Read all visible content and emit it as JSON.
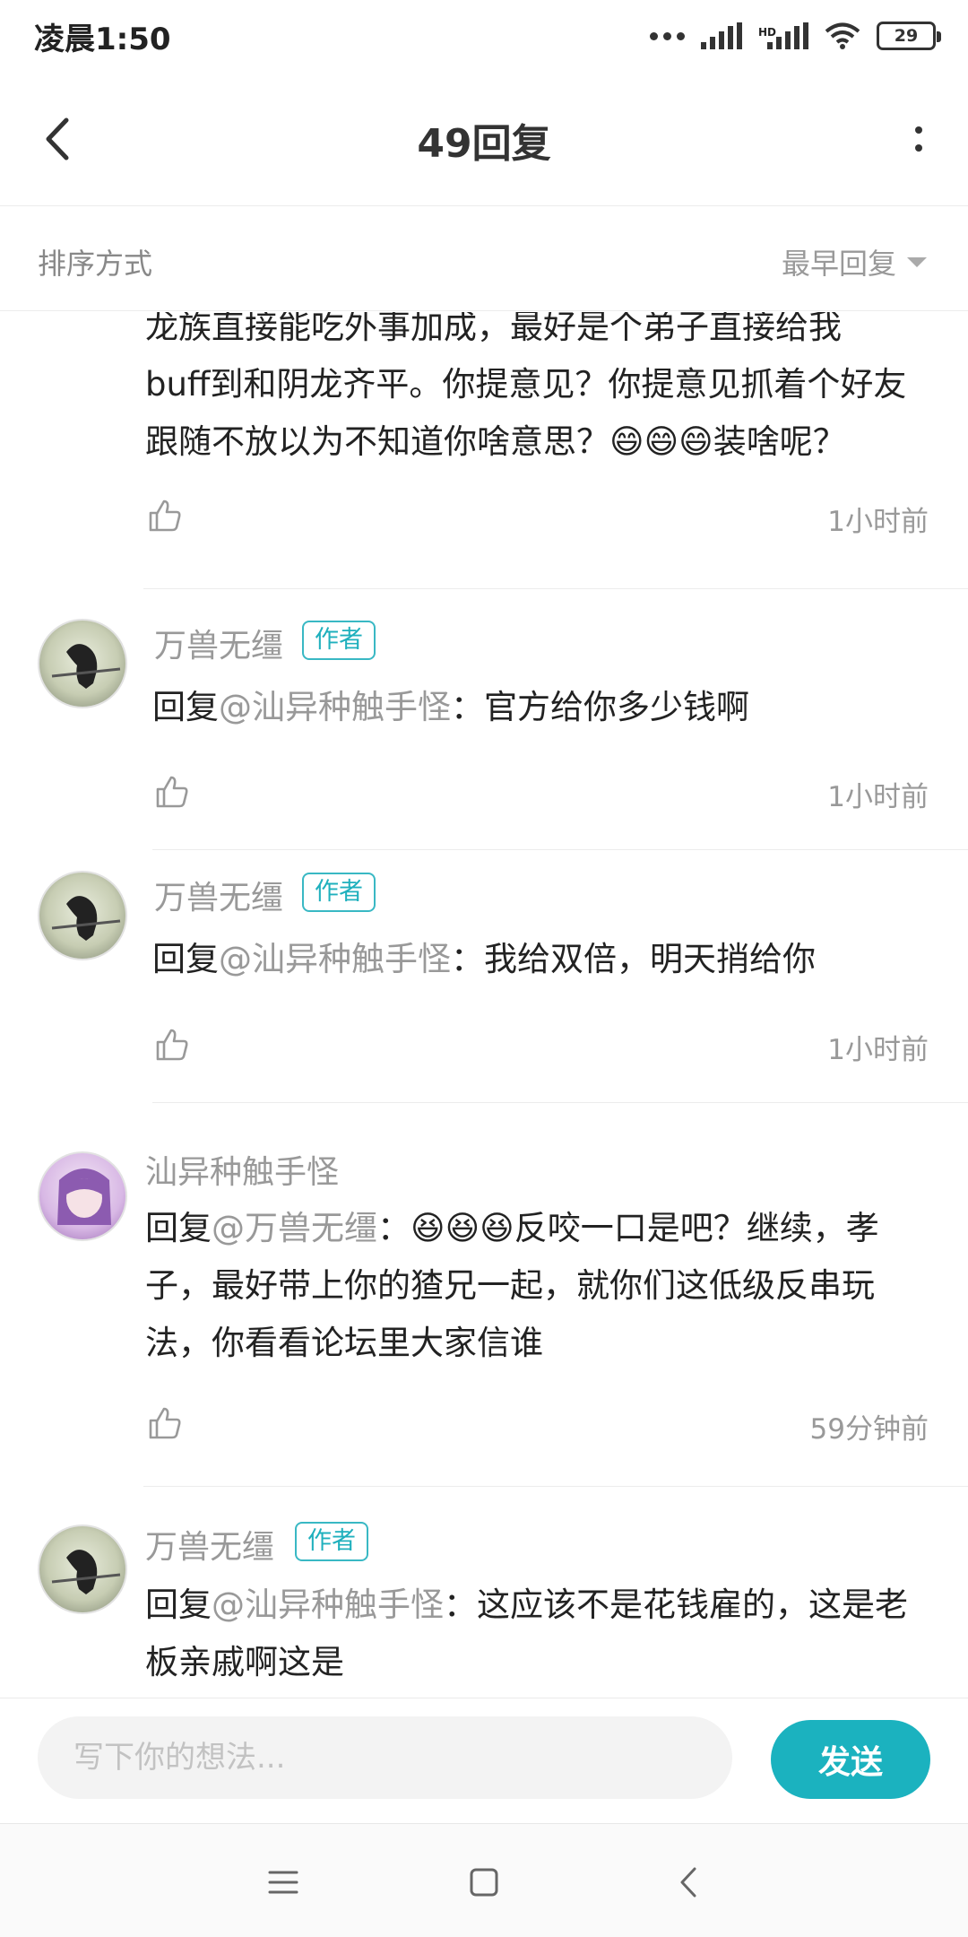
{
  "status_bar": {
    "time": "凌晨1:50",
    "hd": "HD",
    "battery": "29"
  },
  "header": {
    "title": "49回复"
  },
  "sort": {
    "label": "排序方式",
    "value": "最早回复"
  },
  "comments": [
    {
      "text_lines": [
        "龙族直接能吃外事加成，最好是个弟子直接给我",
        "buff到和阴龙齐平。你提意见？你提意见抓着个好友",
        "跟随不放以为不知道你啥意思？😄😄😄装啥呢？"
      ],
      "time": "1小时前"
    },
    {
      "username": "万兽无缰",
      "badge": "作者",
      "reply_prefix": "回复",
      "at_name": "@汕异种触手怪",
      "text": "：官方给你多少钱啊",
      "time": "1小时前"
    },
    {
      "username": "万兽无缰",
      "badge": "作者",
      "reply_prefix": "回复",
      "at_name": "@汕异种触手怪",
      "text": "：我给双倍，明天捎给你",
      "time": "1小时前"
    },
    {
      "username": "汕异种触手怪",
      "reply_prefix": "回复",
      "at_name": "@万兽无缰",
      "text": "：😆😆😆反咬一口是吧？继续，孝子，最好带上你的猹兄一起，就你们这低级反串玩法，你看看论坛里大家信谁",
      "time": "59分钟前"
    },
    {
      "username": "万兽无缰",
      "badge": "作者",
      "reply_prefix": "回复",
      "at_name": "@汕异种触手怪",
      "text": "：这应该不是花钱雇的，这是老板亲戚啊这是"
    }
  ],
  "composer": {
    "placeholder": "写下你的想法...",
    "send_label": "发送"
  }
}
